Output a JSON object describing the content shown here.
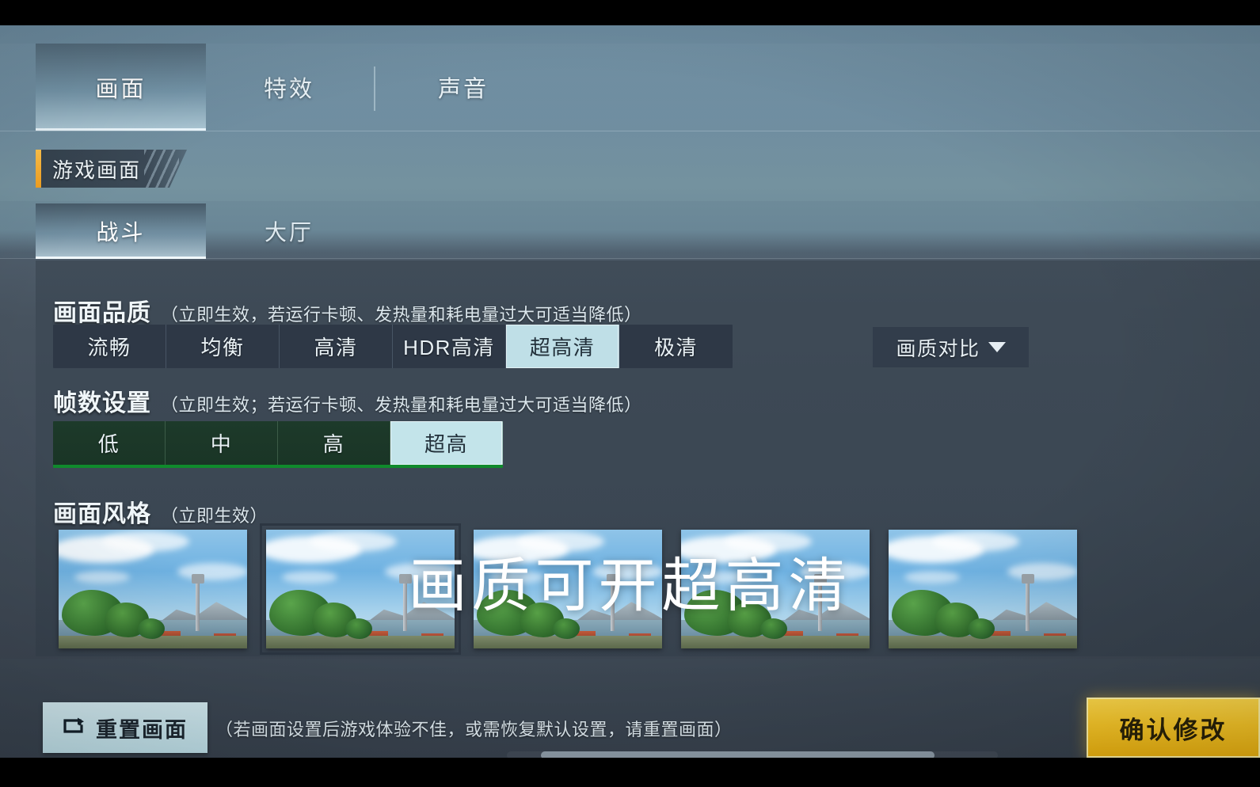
{
  "top_tabs": [
    {
      "label": "画面",
      "active": true
    },
    {
      "label": "特效",
      "active": false
    },
    {
      "label": "声音",
      "active": false
    }
  ],
  "section": {
    "title": "游戏画面"
  },
  "sub_tabs": [
    {
      "label": "战斗",
      "active": true
    },
    {
      "label": "大厅",
      "active": false
    }
  ],
  "quality": {
    "label": "画面品质",
    "note": "（立即生效，若运行卡顿、发热量和耗电量过大可适当降低）",
    "options": [
      "流畅",
      "均衡",
      "高清",
      "HDR高清",
      "超高清",
      "极清"
    ],
    "selected": "超高清"
  },
  "compare_button": {
    "label": "画质对比",
    "icon": "chevron-down-icon"
  },
  "framerate": {
    "label": "帧数设置",
    "note": "（立即生效；若运行卡顿、发热量和耗电量过大可适当降低）",
    "options": [
      "低",
      "中",
      "高",
      "超高"
    ],
    "selected": "超高",
    "accent_color": "#0f8a2c"
  },
  "style": {
    "label": "画面风格",
    "note": "（立即生效）",
    "thumbnails": [
      {
        "name": "style-1",
        "selected": false
      },
      {
        "name": "style-2",
        "selected": true
      },
      {
        "name": "style-3",
        "selected": false
      },
      {
        "name": "style-4",
        "selected": false
      },
      {
        "name": "style-5",
        "selected": false
      }
    ]
  },
  "overlay_caption": "画质可开超高清",
  "footer": {
    "reset_label": "重置画面",
    "reset_icon": "reset-loop-icon",
    "reset_hint": "（若画面设置后游戏体验不佳，或需恢复默认设置，请重置画面）",
    "confirm_label": "确认修改",
    "confirm_color": "#f9c828"
  }
}
